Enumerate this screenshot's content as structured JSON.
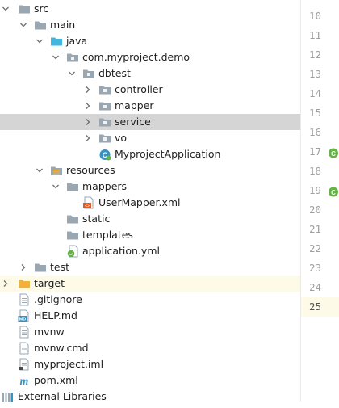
{
  "project_tree": {
    "rows": [
      {
        "label": "src",
        "icon": "folder-icon",
        "depth": 0,
        "chevron": "down",
        "selected": false,
        "highlight": false
      },
      {
        "label": "main",
        "icon": "folder-icon",
        "depth": 1,
        "chevron": "down",
        "selected": false,
        "highlight": false
      },
      {
        "label": "java",
        "icon": "source-folder-icon",
        "depth": 2,
        "chevron": "down",
        "selected": false,
        "highlight": false
      },
      {
        "label": "com.myproject.demo",
        "icon": "package-icon",
        "depth": 3,
        "chevron": "down",
        "selected": false,
        "highlight": false
      },
      {
        "label": "dbtest",
        "icon": "package-icon",
        "depth": 4,
        "chevron": "down",
        "selected": false,
        "highlight": false
      },
      {
        "label": "controller",
        "icon": "package-icon",
        "depth": 5,
        "chevron": "right",
        "selected": false,
        "highlight": false
      },
      {
        "label": "mapper",
        "icon": "package-icon",
        "depth": 5,
        "chevron": "right",
        "selected": false,
        "highlight": false
      },
      {
        "label": "service",
        "icon": "package-icon",
        "depth": 5,
        "chevron": "right",
        "selected": true,
        "highlight": false
      },
      {
        "label": "vo",
        "icon": "package-icon",
        "depth": 5,
        "chevron": "right",
        "selected": false,
        "highlight": false
      },
      {
        "label": "MyprojectApplication",
        "icon": "spring-class-icon",
        "depth": 5,
        "chevron": "none",
        "selected": false,
        "highlight": false
      },
      {
        "label": "resources",
        "icon": "resources-folder-icon",
        "depth": 2,
        "chevron": "down",
        "selected": false,
        "highlight": false
      },
      {
        "label": "mappers",
        "icon": "folder-icon",
        "depth": 3,
        "chevron": "down",
        "selected": false,
        "highlight": false
      },
      {
        "label": "UserMapper.xml",
        "icon": "xml-file-icon",
        "depth": 4,
        "chevron": "none",
        "selected": false,
        "highlight": false
      },
      {
        "label": "static",
        "icon": "folder-icon",
        "depth": 3,
        "chevron": "none",
        "selected": false,
        "highlight": false
      },
      {
        "label": "templates",
        "icon": "folder-icon",
        "depth": 3,
        "chevron": "none",
        "selected": false,
        "highlight": false
      },
      {
        "label": "application.yml",
        "icon": "yml-file-icon",
        "depth": 3,
        "chevron": "none",
        "selected": false,
        "highlight": false
      },
      {
        "label": "test",
        "icon": "folder-icon",
        "depth": 1,
        "chevron": "right",
        "selected": false,
        "highlight": false
      },
      {
        "label": "target",
        "icon": "excluded-folder-icon",
        "depth": 0,
        "chevron": "right",
        "selected": false,
        "highlight": true
      },
      {
        "label": ".gitignore",
        "icon": "text-file-icon",
        "depth": 0,
        "chevron": "none",
        "selected": false,
        "highlight": false
      },
      {
        "label": "HELP.md",
        "icon": "markdown-file-icon",
        "depth": 0,
        "chevron": "none",
        "selected": false,
        "highlight": false
      },
      {
        "label": "mvnw",
        "icon": "text-file-icon",
        "depth": 0,
        "chevron": "none",
        "selected": false,
        "highlight": false
      },
      {
        "label": "mvnw.cmd",
        "icon": "text-file-icon",
        "depth": 0,
        "chevron": "none",
        "selected": false,
        "highlight": false
      },
      {
        "label": "myproject.iml",
        "icon": "iml-file-icon",
        "depth": 0,
        "chevron": "none",
        "selected": false,
        "highlight": false
      },
      {
        "label": "pom.xml",
        "icon": "maven-icon",
        "depth": 0,
        "chevron": "none",
        "selected": false,
        "highlight": false
      },
      {
        "label": "External Libraries",
        "icon": "libraries-icon",
        "depth": -1,
        "chevron": "none",
        "selected": false,
        "highlight": false
      }
    ]
  },
  "gutter": {
    "lines": [
      {
        "number": "10",
        "run_icon": false,
        "current": false
      },
      {
        "number": "11",
        "run_icon": false,
        "current": false
      },
      {
        "number": "12",
        "run_icon": false,
        "current": false
      },
      {
        "number": "13",
        "run_icon": false,
        "current": false
      },
      {
        "number": "14",
        "run_icon": false,
        "current": false
      },
      {
        "number": "15",
        "run_icon": false,
        "current": false
      },
      {
        "number": "16",
        "run_icon": false,
        "current": false
      },
      {
        "number": "17",
        "run_icon": true,
        "current": false
      },
      {
        "number": "18",
        "run_icon": false,
        "current": false
      },
      {
        "number": "19",
        "run_icon": true,
        "current": false
      },
      {
        "number": "20",
        "run_icon": false,
        "current": false
      },
      {
        "number": "21",
        "run_icon": false,
        "current": false
      },
      {
        "number": "22",
        "run_icon": false,
        "current": false
      },
      {
        "number": "23",
        "run_icon": false,
        "current": false
      },
      {
        "number": "24",
        "run_icon": false,
        "current": false
      },
      {
        "number": "25",
        "run_icon": false,
        "current": true
      }
    ]
  },
  "colors": {
    "selection": "#d5d5d5",
    "current_line": "#fdfbe8",
    "folder": "#9aa7b0",
    "source_folder": "#40b6e0",
    "excluded_folder": "#f4af3d",
    "spring": "#62b543",
    "xml": "#e05a24"
  }
}
